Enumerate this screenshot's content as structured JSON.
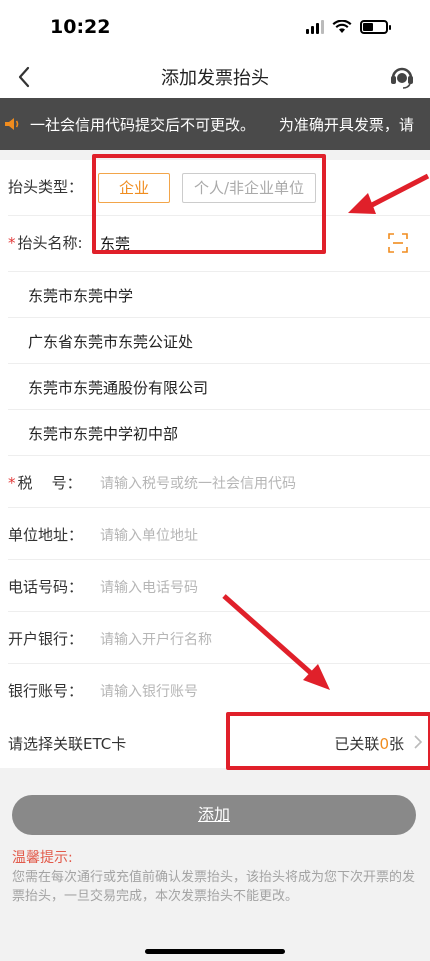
{
  "status_bar": {
    "time": "10:22",
    "battery_level": 0.45
  },
  "nav": {
    "title": "添加发票抬头",
    "back_icon": "chevron-left-icon",
    "support_icon": "headset-icon"
  },
  "notice": {
    "text": "一社会信用代码提交后不可更改。     为准确开具发票，请",
    "icon": "speaker-icon"
  },
  "form": {
    "type": {
      "label": "抬头类型：",
      "options": [
        "企业",
        "个人/非企业单位"
      ],
      "selected": "企业"
    },
    "name": {
      "required_mark": "*",
      "label": "抬头名称:",
      "value": "东莞"
    },
    "suggestions": [
      "东莞市东莞中学",
      "广东省东莞市东莞公证处",
      "东莞市东莞通股份有限公司",
      "东莞市东莞中学初中部"
    ],
    "tax": {
      "required_mark": "*",
      "label": "税    号：",
      "placeholder": "请输入税号或统一社会信用代码"
    },
    "address": {
      "label": "单位地址：",
      "placeholder": "请输入单位地址"
    },
    "phone": {
      "label": "电话号码：",
      "placeholder": "请输入电话号码"
    },
    "bank": {
      "label": "开户银行：",
      "placeholder": "请输入开户行名称"
    },
    "account": {
      "label": "银行账号：",
      "placeholder": "请输入银行账号"
    }
  },
  "etc": {
    "label": "请选择关联ETC卡",
    "status_prefix": "已关联",
    "count": "0",
    "unit": "张"
  },
  "actions": {
    "add_label": "添加"
  },
  "tips": {
    "title": "温馨提示:",
    "body": "您需在每次通行或充值前确认发票抬头，该抬头将成为您下次开票的发票抬头，一旦交易完成，本次发票抬头不能更改。"
  },
  "colors": {
    "accent": "#f08c1e",
    "annotation": "#e0202a",
    "required": "#e23b3b",
    "button": "#898989"
  }
}
